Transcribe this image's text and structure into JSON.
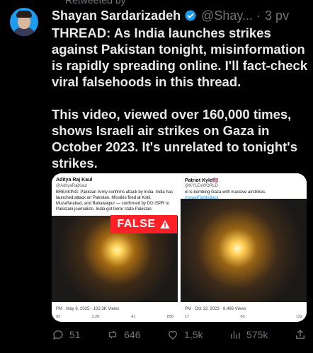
{
  "post": {
    "top_clip": "Retweeted by",
    "author_name": "Shayan Sardarizadeh",
    "author_handle": "@Shay...",
    "time": "3 pv",
    "text_1": "THREAD: As India launches strikes against Pakistan tonight, misinformation is rapidly spreading online. I'll fact-check viral falsehoods in this thread.",
    "text_2": "This video, viewed over 160,000 times, shows Israeli air strikes on Gaza in October 2023. It's unrelated to tonight's strikes."
  },
  "media": {
    "false_label": "FALSE",
    "left_card": {
      "name": "Aditya Raj Kaul",
      "handle": "@AdityaRajKaul",
      "text": "BREAKING: Pakistan Army confirms attack by India. India has launched attack on Pakistan. Missiles fired at Kotli, Muzaffarabad, and Bahawalpur — confirmed by DG ISPR to Pakistani journalists. India got terror state Pakistan.",
      "date": "PM · May 6, 2025 · 102.3K Views",
      "actions": [
        "93",
        "3.2K",
        "41",
        "858"
      ]
    },
    "right_card": {
      "name": "Patriot Kyle🇺🇸",
      "handle": "@KYLEsWORLD",
      "text": "el is bombing Gaza with massive airstrikes.",
      "tag": "#IsraelFightsBack",
      "date": "PM · Oct 13, 2023 · 8,486 Views",
      "actions": [
        "17",
        "60",
        "132"
      ]
    }
  },
  "actions": {
    "replies": "51",
    "retweets": "646",
    "likes": "1,5k",
    "views": "575k"
  },
  "colors": {
    "bg": "#000000",
    "text": "#e7e9ea",
    "muted": "#71767b",
    "verified": "#1d9bf0",
    "false_red": "#ff1f26"
  }
}
